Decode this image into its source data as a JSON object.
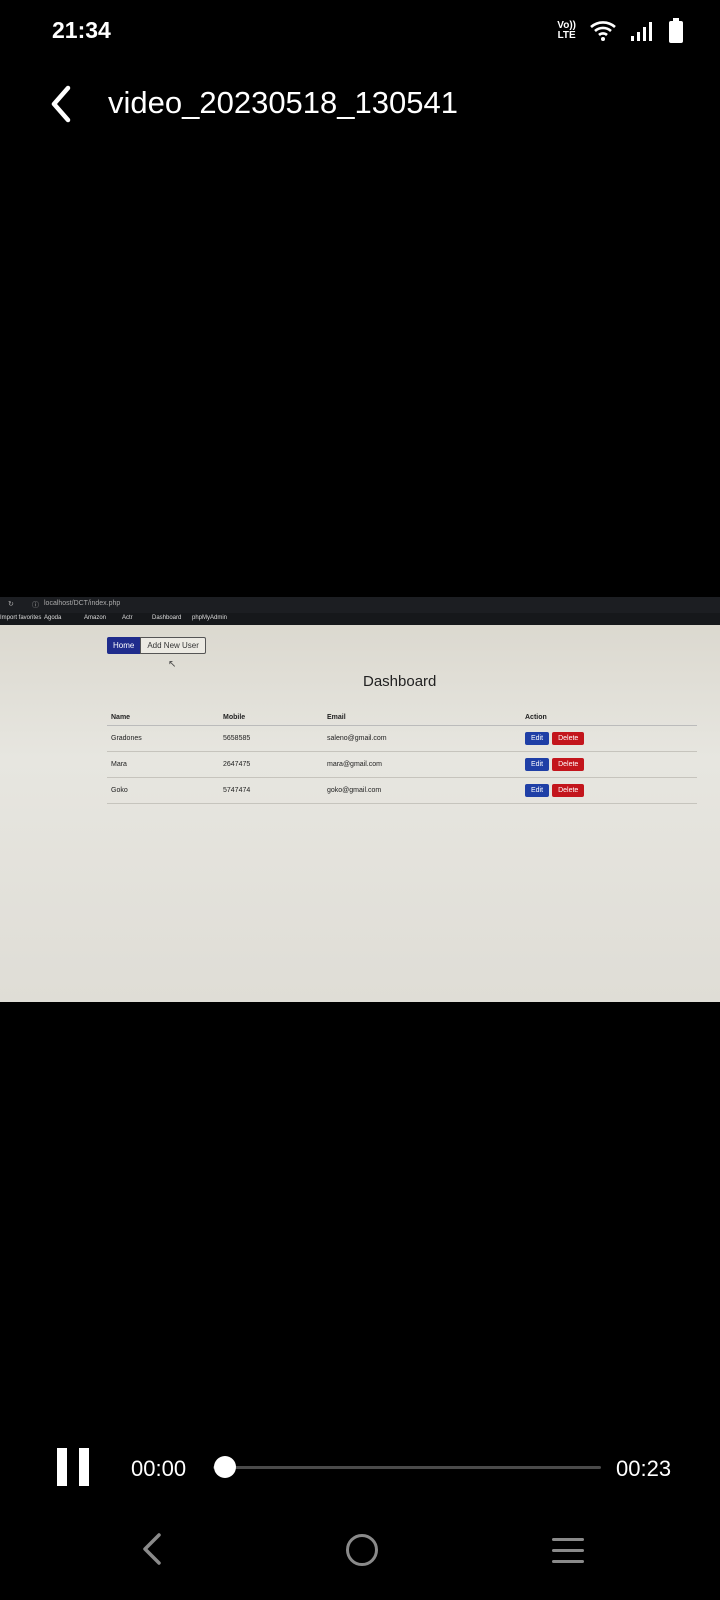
{
  "status_bar": {
    "time": "21:34",
    "volte_line1": "Vo))",
    "volte_line2": "LTE",
    "icons": [
      "volte-icon",
      "wifi-icon",
      "signal-icon",
      "battery-icon"
    ]
  },
  "header": {
    "back_icon": "chevron-left-icon",
    "title": "video_20230518_130541"
  },
  "video_frame": {
    "browser": {
      "url": "localhost/DCT/index.php",
      "bookmarks": [
        "Import favorites",
        "Agoda",
        "Amazon",
        "Actr",
        "Dashboard",
        "phpMyAdmin"
      ]
    },
    "nav": {
      "home": "Home",
      "add_new_user": "Add New User"
    },
    "page_title": "Dashboard",
    "table": {
      "columns": [
        "Name",
        "Mobile",
        "Email",
        "Action"
      ],
      "rows": [
        {
          "name": "Gradones",
          "mobile": "5658585",
          "email": "saleno@gmail.com"
        },
        {
          "name": "Mara",
          "mobile": "2647475",
          "email": "mara@gmail.com"
        },
        {
          "name": "Goko",
          "mobile": "5747474",
          "email": "goko@gmail.com"
        }
      ],
      "edit_label": "Edit",
      "delete_label": "Delete"
    }
  },
  "player": {
    "current_time": "00:00",
    "duration": "00:23",
    "progress_fraction": 0.0,
    "pause_icon": "pause-icon"
  },
  "colors": {
    "accent": "#3b74ff",
    "edit_button": "#1f3fa6",
    "delete_button": "#c3151c"
  }
}
